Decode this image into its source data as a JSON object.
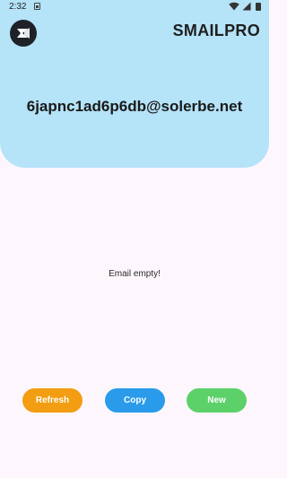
{
  "status_bar": {
    "time": "2:32"
  },
  "header": {
    "app_title": "SMAILPRO",
    "email": "6japnc1ad6p6db@solerbe.net",
    "background_color": "#b5e3f8"
  },
  "inbox": {
    "empty_message": "Email empty!"
  },
  "actions": {
    "refresh_label": "Refresh",
    "copy_label": "Copy",
    "new_label": "New",
    "refresh_color": "#f29d12",
    "copy_color": "#2a9bea",
    "new_color": "#5cd169"
  },
  "icons": {
    "logo": "app-logo-icon",
    "sim": "sim-card-icon",
    "wifi": "wifi-icon",
    "signal": "cell-signal-icon",
    "battery": "battery-icon"
  }
}
